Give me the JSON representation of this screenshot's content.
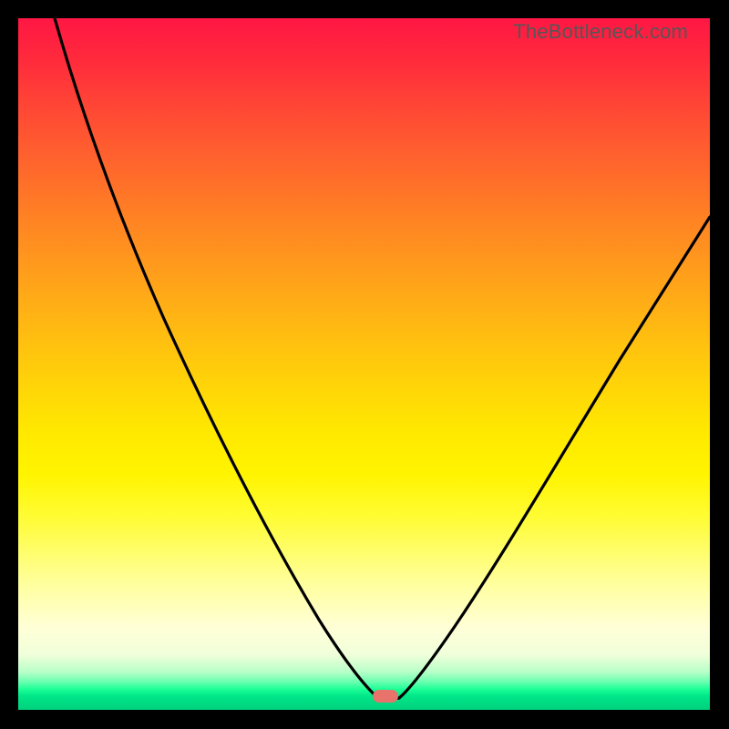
{
  "watermark": "TheBottleneck.com",
  "chart_data": {
    "type": "line",
    "title": "",
    "xlabel": "",
    "ylabel": "",
    "x": [
      0.0,
      0.05,
      0.1,
      0.15,
      0.2,
      0.25,
      0.3,
      0.35,
      0.4,
      0.45,
      0.5,
      0.53,
      0.55,
      0.6,
      0.65,
      0.7,
      0.75,
      0.8,
      0.85,
      0.9,
      0.95,
      1.0
    ],
    "values": [
      1.0,
      0.89,
      0.78,
      0.67,
      0.56,
      0.45,
      0.35,
      0.25,
      0.16,
      0.08,
      0.02,
      0.0,
      0.01,
      0.07,
      0.15,
      0.24,
      0.33,
      0.42,
      0.51,
      0.59,
      0.66,
      0.72
    ],
    "xlim": [
      0,
      1
    ],
    "ylim": [
      0,
      1
    ],
    "annotations": [
      {
        "type": "pill",
        "x": 0.525,
        "y": 0.008
      }
    ]
  },
  "gradient": {
    "top": "#ff1744",
    "mid": "#ffe900",
    "bottom": "#00d07c"
  }
}
